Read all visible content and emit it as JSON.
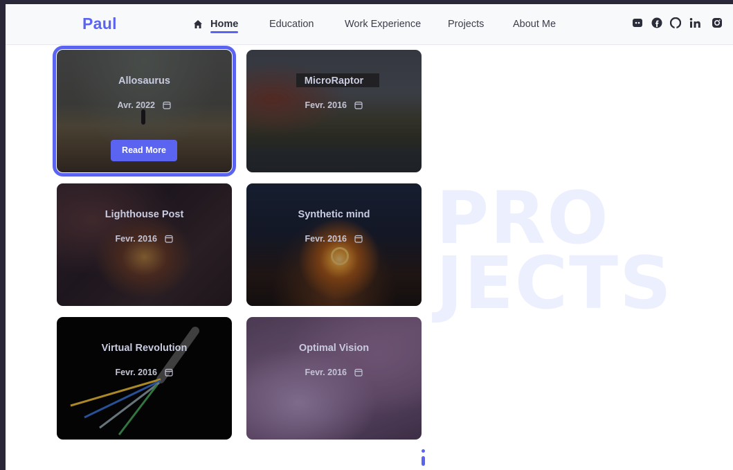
{
  "brand": "Paul",
  "nav": {
    "items": [
      {
        "label": "Home",
        "active": true
      },
      {
        "label": "Education",
        "active": false
      },
      {
        "label": "Work Experience",
        "active": false
      },
      {
        "label": "Projects",
        "active": false
      },
      {
        "label": "About Me",
        "active": false
      }
    ]
  },
  "social": [
    "discord-icon",
    "facebook-icon",
    "github-icon",
    "linkedin-icon",
    "instagram-icon"
  ],
  "watermark": {
    "line1": "PRO",
    "line2": "JECTS"
  },
  "cards": [
    {
      "title": "Allosaurus",
      "date": "Avr. 2022",
      "button": "Read More"
    },
    {
      "title": "MicroRaptor",
      "date": "Fevr. 2016"
    },
    {
      "title": "Lighthouse Post",
      "date": "Fevr. 2016"
    },
    {
      "title": "Synthetic mind",
      "date": "Fevr. 2016"
    },
    {
      "title": "Virtual Revolution",
      "date": "Fevr. 2016"
    },
    {
      "title": "Optimal Vision",
      "date": "Fevr. 2016"
    }
  ],
  "colors": {
    "accent": "#5b64f0",
    "watermark": "#eceffd"
  }
}
